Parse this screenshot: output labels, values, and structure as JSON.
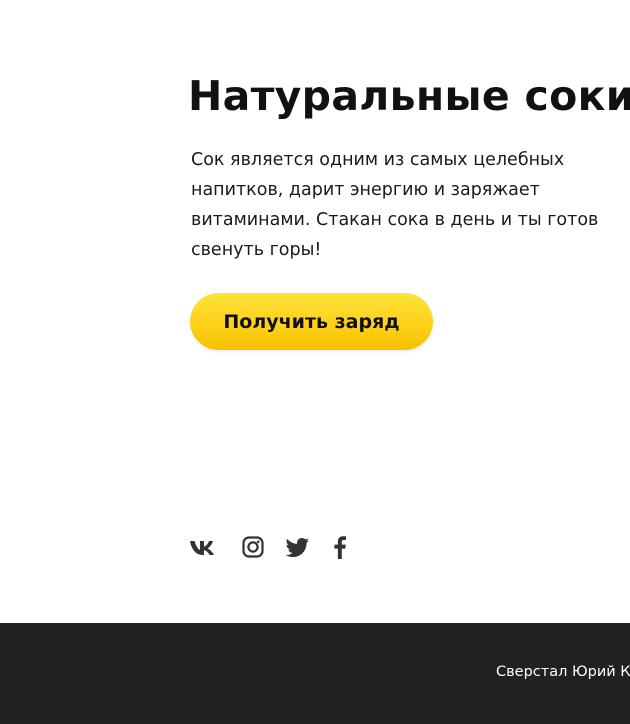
{
  "hero": {
    "title": "Натуральные соки",
    "description": "Сок является одним из самых целебных напитков, дарит энергию и заряжает витаминами. Стакан сока в день и ты готов свенуть горы!",
    "button_label": "Получить заряд"
  },
  "social": {
    "icons": [
      "vk-icon",
      "instagram-icon",
      "twitter-icon",
      "facebook-icon"
    ],
    "icon_color": "#333333"
  },
  "footer": {
    "credit": "Сверстал Юрий Кл"
  },
  "colors": {
    "accent": "#fed11a",
    "footer_bg": "#212121",
    "text": "#111111"
  }
}
